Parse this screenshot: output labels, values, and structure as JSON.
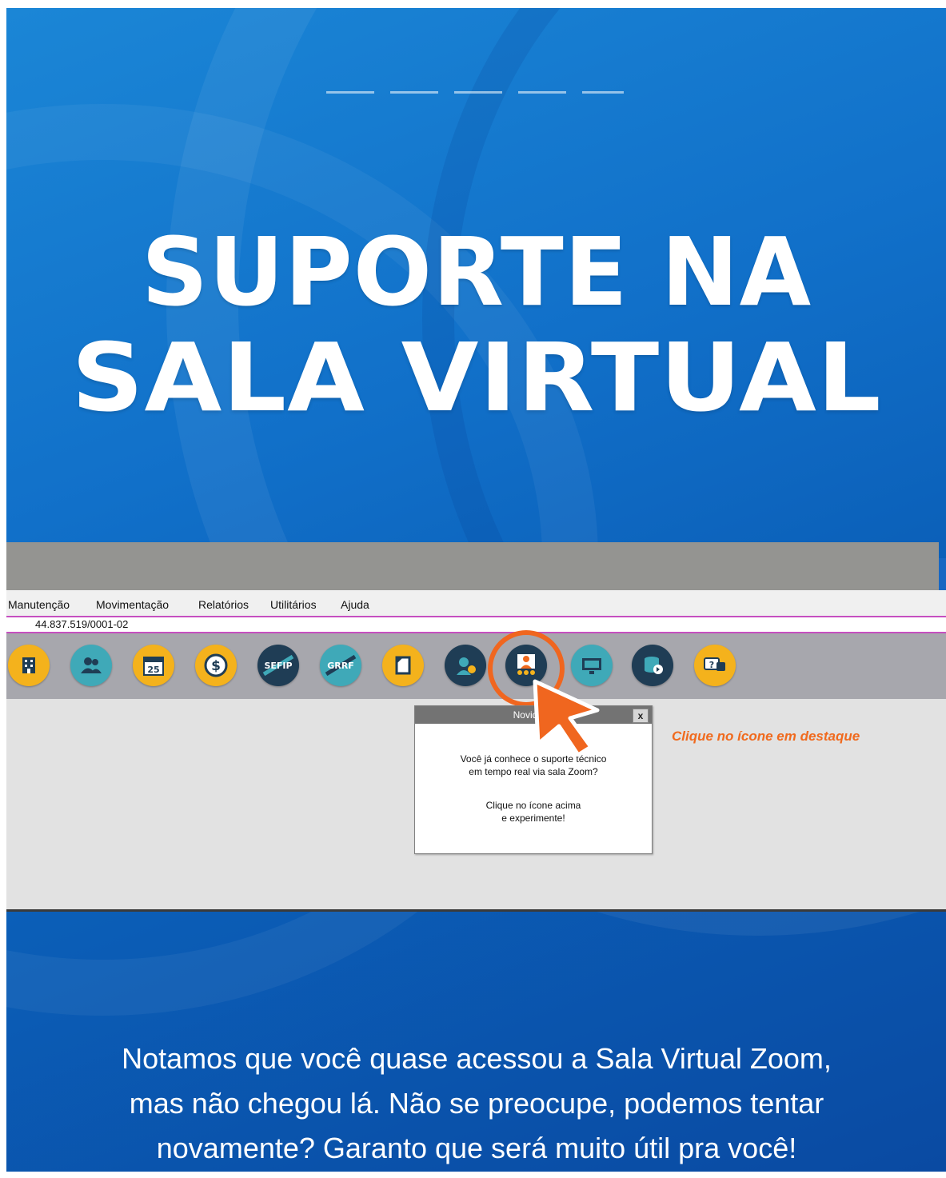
{
  "headline": {
    "line1": "SUPORTE NA",
    "line2": "SALA VIRTUAL"
  },
  "app": {
    "menu": [
      "Manutenção",
      "Movimentação",
      "Relatórios",
      "Utilitários",
      "Ajuda"
    ],
    "cnpj": "44.837.519/0001-02",
    "toolbar": [
      {
        "icon": "building-icon",
        "color": "yellow"
      },
      {
        "icon": "users-icon",
        "color": "teal"
      },
      {
        "icon": "calendar-icon",
        "color": "yellow",
        "label": "25"
      },
      {
        "icon": "dollar-coin-icon",
        "color": "yellow",
        "label": "$"
      },
      {
        "icon": "sefip-icon",
        "color": "dark",
        "label": "SEFIP"
      },
      {
        "icon": "grrf-icon",
        "color": "teal",
        "label": "GRRF"
      },
      {
        "icon": "document-icon",
        "color": "yellow"
      },
      {
        "icon": "support-agent-icon",
        "color": "dark"
      },
      {
        "icon": "virtual-room-icon",
        "color": "dark",
        "highlighted": true
      },
      {
        "icon": "monitor-icon",
        "color": "teal"
      },
      {
        "icon": "database-icon",
        "color": "dark"
      },
      {
        "icon": "help-chat-icon",
        "color": "yellow",
        "label": "?"
      }
    ],
    "popup": {
      "title": "Novidade",
      "line1": "Você já conhece o suporte técnico",
      "line2": "em tempo real via sala Zoom?",
      "line3": "Clique no ícone acima",
      "line4": "e experimente!",
      "close": "x"
    },
    "hint": "Clique no ícone em destaque"
  },
  "footer": {
    "line1": "Notamos que você quase acessou a Sala Virtual Zoom,",
    "line2": "mas não chegou lá. Não se preocupe, podemos tentar",
    "line3": "novamente? Garanto que será muito útil pra você!"
  },
  "colors": {
    "accent_orange": "#f0661f",
    "background_blue": "#1170c9",
    "toolbar_gray": "#a7a7ad"
  }
}
